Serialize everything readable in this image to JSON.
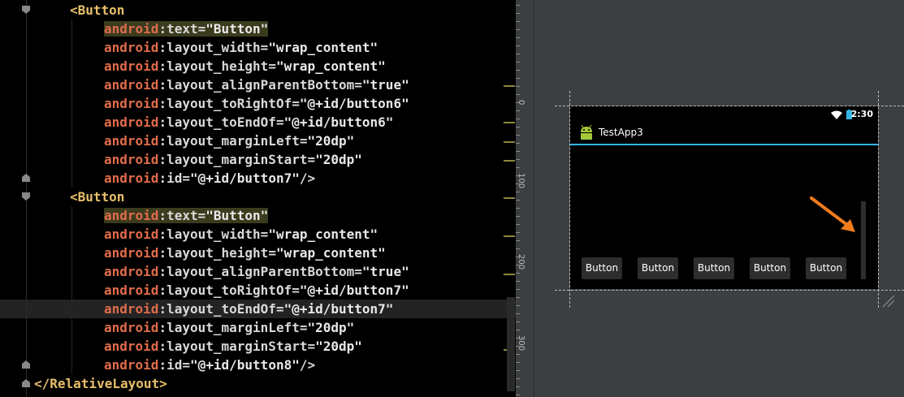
{
  "editor": {
    "lines": [
      {
        "indent": 0,
        "tag_open": "<Button"
      },
      {
        "indent": 1,
        "ns": "android",
        "attr": "text",
        "value": "\"Button\"",
        "highlight": true
      },
      {
        "indent": 1,
        "ns": "android",
        "attr": "layout_width",
        "value": "\"wrap_content\""
      },
      {
        "indent": 1,
        "ns": "android",
        "attr": "layout_height",
        "value": "\"wrap_content\""
      },
      {
        "indent": 1,
        "ns": "android",
        "attr": "layout_alignParentBottom",
        "value": "\"true\""
      },
      {
        "indent": 1,
        "ns": "android",
        "attr": "layout_toRightOf",
        "value": "\"@+id/button6\""
      },
      {
        "indent": 1,
        "ns": "android",
        "attr": "layout_toEndOf",
        "value": "\"@+id/button6\""
      },
      {
        "indent": 1,
        "ns": "android",
        "attr": "layout_marginLeft",
        "value": "\"20dp\""
      },
      {
        "indent": 1,
        "ns": "android",
        "attr": "layout_marginStart",
        "value": "\"20dp\""
      },
      {
        "indent": 1,
        "ns": "android",
        "attr": "id",
        "value": "\"@+id/button7\"",
        "close": "/>"
      },
      {
        "indent": 0,
        "tag_open": "<Button"
      },
      {
        "indent": 1,
        "ns": "android",
        "attr": "text",
        "value": "\"Button\"",
        "highlight": true
      },
      {
        "indent": 1,
        "ns": "android",
        "attr": "layout_width",
        "value": "\"wrap_content\""
      },
      {
        "indent": 1,
        "ns": "android",
        "attr": "layout_height",
        "value": "\"wrap_content\""
      },
      {
        "indent": 1,
        "ns": "android",
        "attr": "layout_alignParentBottom",
        "value": "\"true\""
      },
      {
        "indent": 1,
        "ns": "android",
        "attr": "layout_toRightOf",
        "value": "\"@+id/button7\""
      },
      {
        "indent": 1,
        "ns": "android",
        "attr": "layout_toEndOf",
        "value": "\"@+id/button7\""
      },
      {
        "indent": 1,
        "ns": "android",
        "attr": "layout_marginLeft",
        "value": "\"20dp\""
      },
      {
        "indent": 1,
        "ns": "android",
        "attr": "layout_marginStart",
        "value": "\"20dp\""
      },
      {
        "indent": 1,
        "ns": "android",
        "attr": "id",
        "value": "\"@+id/button8\"",
        "close": "/>"
      },
      {
        "indent": -1,
        "tag_close": "</RelativeLayout>"
      }
    ],
    "colors": {
      "tag": "#e8bf6a",
      "namespace": "#e06c4b",
      "string": "#e8e8e8"
    }
  },
  "designer": {
    "ruler_labels": [
      "0",
      "100",
      "200",
      "300"
    ],
    "device": {
      "clock": "2:30",
      "app_title": "TestApp3",
      "buttons": [
        "Button",
        "Button",
        "Button",
        "Button",
        "Button"
      ],
      "accent_color": "#33b5e5"
    },
    "annotation_color": "#f07c1e"
  }
}
